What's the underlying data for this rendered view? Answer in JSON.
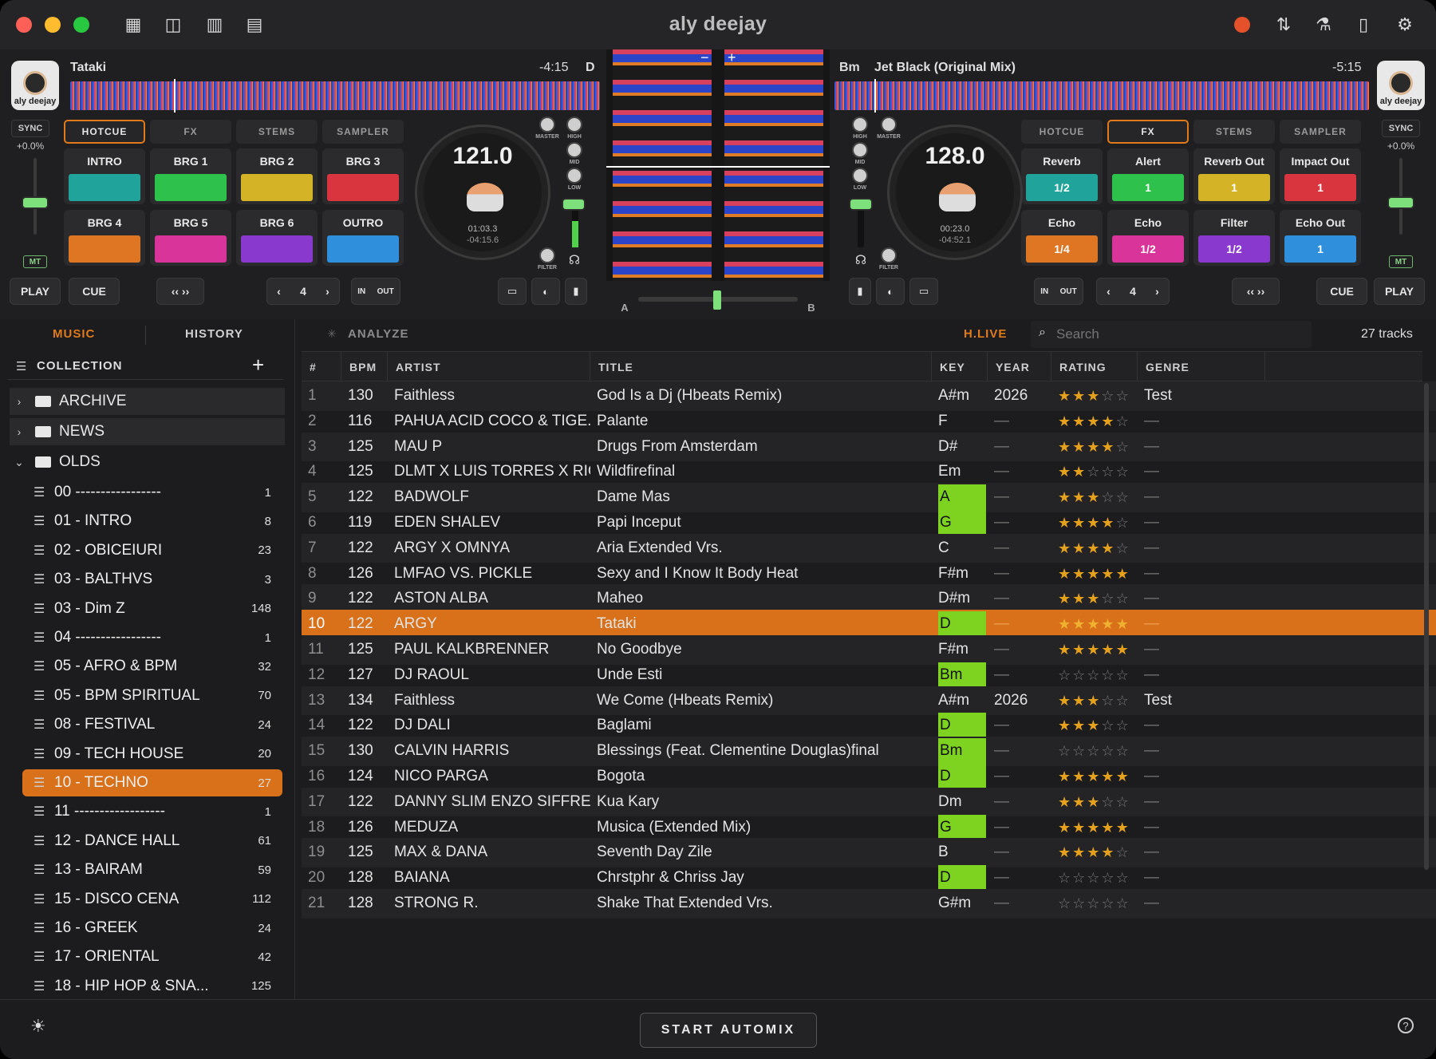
{
  "app": {
    "title": "aly deejay",
    "brand_badge": "aly deejay"
  },
  "deck_a": {
    "track": "Tataki",
    "remaining": "-4:15",
    "key": "D",
    "sync": "SYNC",
    "pitch": "+0.0%",
    "mt": "MT",
    "tabs": [
      "HOTCUE",
      "FX",
      "STEMS",
      "SAMPLER"
    ],
    "active_tab": 0,
    "pads": [
      {
        "label": "INTRO",
        "color": "#1fa39a",
        "value": ""
      },
      {
        "label": "BRG 1",
        "color": "#2ec24c",
        "value": ""
      },
      {
        "label": "BRG 2",
        "color": "#d4b426",
        "value": ""
      },
      {
        "label": "BRG 3",
        "color": "#d8353f",
        "value": ""
      },
      {
        "label": "BRG 4",
        "color": "#de7624",
        "value": ""
      },
      {
        "label": "BRG 5",
        "color": "#d8349a",
        "value": ""
      },
      {
        "label": "BRG 6",
        "color": "#8a39cf",
        "value": ""
      },
      {
        "label": "OUTRO",
        "color": "#2f8fdc",
        "value": ""
      }
    ],
    "bpm": "121.0",
    "elapsed": "01:03.3",
    "remaining_detail": "-04:15.6",
    "knob_labels": {
      "master": "MASTER",
      "high": "HIGH",
      "mid": "MID",
      "low": "LOW",
      "filter": "FILTER"
    },
    "buttons": {
      "play": "PLAY",
      "cue": "CUE",
      "loop_nav": "‹‹ ››",
      "loop_prev": "‹",
      "loop_size": "4",
      "loop_next": "›",
      "in": "IN",
      "out": "OUT"
    },
    "vu_level": 0.55
  },
  "deck_b": {
    "track": "Jet Black (Original Mix)",
    "remaining": "-5:15",
    "key": "Bm",
    "sync": "SYNC",
    "pitch": "+0.0%",
    "mt": "MT",
    "tabs": [
      "HOTCUE",
      "FX",
      "STEMS",
      "SAMPLER"
    ],
    "active_tab": 1,
    "pads": [
      {
        "label": "Reverb",
        "color": "#1fa39a",
        "value": "1/2"
      },
      {
        "label": "Alert",
        "color": "#2ec24c",
        "value": "1"
      },
      {
        "label": "Reverb Out",
        "color": "#d4b426",
        "value": "1"
      },
      {
        "label": "Impact Out",
        "color": "#d8353f",
        "value": "1"
      },
      {
        "label": "Echo",
        "color": "#de7624",
        "value": "1/4"
      },
      {
        "label": "Echo",
        "color": "#d8349a",
        "value": "1/2"
      },
      {
        "label": "Filter",
        "color": "#8a39cf",
        "value": "1/2"
      },
      {
        "label": "Echo Out",
        "color": "#2f8fdc",
        "value": "1"
      }
    ],
    "bpm": "128.0",
    "elapsed": "00:23.0",
    "remaining_detail": "-04:52.1",
    "knob_labels": {
      "master": "MASTER",
      "high": "HIGH",
      "mid": "MID",
      "low": "LOW",
      "filter": "FILTER"
    },
    "buttons": {
      "play": "PLAY",
      "cue": "CUE",
      "loop_nav": "‹‹ ››",
      "loop_prev": "‹",
      "loop_size": "4",
      "loop_next": "›",
      "in": "IN",
      "out": "OUT"
    },
    "vu_level": 0.0
  },
  "crossfader": {
    "left": "A",
    "right": "B",
    "position": 0.5
  },
  "sidebar": {
    "tabs": [
      "MUSIC",
      "HISTORY"
    ],
    "active_tab": 0,
    "collection_label": "COLLECTION",
    "add": "+",
    "folders": [
      {
        "name": "ARCHIVE",
        "expanded": false
      },
      {
        "name": "NEWS",
        "expanded": false
      },
      {
        "name": "OLDS",
        "expanded": true
      }
    ],
    "playlists": [
      {
        "name": "00 -----------------",
        "count": "1"
      },
      {
        "name": "01 - INTRO",
        "count": "8"
      },
      {
        "name": "02 - OBICEIURI",
        "count": "23"
      },
      {
        "name": "03 - BALTHVS",
        "count": "3"
      },
      {
        "name": "03 - Dim Z",
        "count": "148"
      },
      {
        "name": "04 -----------------",
        "count": "1"
      },
      {
        "name": "05 - AFRO & BPM",
        "count": "32"
      },
      {
        "name": "05 - BPM SPIRITUAL",
        "count": "70"
      },
      {
        "name": "08 - FESTIVAL",
        "count": "24"
      },
      {
        "name": "09 - TECH HOUSE",
        "count": "20"
      },
      {
        "name": "10 - TECHNO",
        "count": "27"
      },
      {
        "name": "11 ------------------",
        "count": "1"
      },
      {
        "name": "12 - DANCE HALL",
        "count": "61"
      },
      {
        "name": "13 - BAIRAM",
        "count": "59"
      },
      {
        "name": "15 - DISCO CENA",
        "count": "112"
      },
      {
        "name": "16 - GREEK",
        "count": "24"
      },
      {
        "name": "17 - ORIENTAL",
        "count": "42"
      },
      {
        "name": "18 - HIP HOP & SNA...",
        "count": "125"
      }
    ],
    "selected_playlist": 10
  },
  "toolbar": {
    "analyze": "ANALYZE",
    "live": "H.LIVE",
    "search_placeholder": "Search",
    "track_count": "27 tracks"
  },
  "table": {
    "columns": [
      "#",
      "BPM",
      "ARTIST",
      "TITLE",
      "KEY",
      "YEAR",
      "RATING",
      "GENRE"
    ],
    "selected_row": 9,
    "rows": [
      {
        "n": "1",
        "bpm": "130",
        "artist": "Faithless",
        "title": "God Is a Dj (Hbeats Remix)",
        "key": "A#m",
        "key_hl": false,
        "year": "2026",
        "rating": 3,
        "genre": "Test"
      },
      {
        "n": "2",
        "bpm": "116",
        "artist": "PAHUA ACID COCO & TIGE...",
        "title": "Palante",
        "key": "F",
        "key_hl": false,
        "year": "—",
        "rating": 4,
        "genre": "—"
      },
      {
        "n": "3",
        "bpm": "125",
        "artist": "MAU P",
        "title": "Drugs From Amsterdam",
        "key": "D#",
        "key_hl": false,
        "year": "—",
        "rating": 4,
        "genre": "—"
      },
      {
        "n": "4",
        "bpm": "125",
        "artist": "DLMT X LUIS TORRES X RIC...",
        "title": "Wildfirefinal",
        "key": "Em",
        "key_hl": false,
        "year": "—",
        "rating": 2,
        "genre": "—"
      },
      {
        "n": "5",
        "bpm": "122",
        "artist": "BADWOLF",
        "title": "Dame Mas",
        "key": "A",
        "key_hl": true,
        "year": "—",
        "rating": 3,
        "genre": "—"
      },
      {
        "n": "6",
        "bpm": "119",
        "artist": "EDEN SHALEV",
        "title": "Papi Inceput",
        "key": "G",
        "key_hl": true,
        "year": "—",
        "rating": 4,
        "genre": "—"
      },
      {
        "n": "7",
        "bpm": "122",
        "artist": "ARGY X OMNYA",
        "title": "Aria Extended Vrs.",
        "key": "C",
        "key_hl": false,
        "year": "—",
        "rating": 4,
        "genre": "—"
      },
      {
        "n": "8",
        "bpm": "126",
        "artist": "LMFAO VS. PICKLE",
        "title": "Sexy and I Know It Body Heat",
        "key": "F#m",
        "key_hl": false,
        "year": "—",
        "rating": 5,
        "genre": "—"
      },
      {
        "n": "9",
        "bpm": "122",
        "artist": "ASTON ALBA",
        "title": "Maheo",
        "key": "D#m",
        "key_hl": false,
        "year": "—",
        "rating": 3,
        "genre": "—"
      },
      {
        "n": "10",
        "bpm": "122",
        "artist": "ARGY",
        "title": "Tataki",
        "key": "D",
        "key_hl": true,
        "year": "—",
        "rating": 5,
        "genre": "—"
      },
      {
        "n": "11",
        "bpm": "125",
        "artist": "PAUL KALKBRENNER",
        "title": "No Goodbye",
        "key": "F#m",
        "key_hl": false,
        "year": "—",
        "rating": 5,
        "genre": "—"
      },
      {
        "n": "12",
        "bpm": "127",
        "artist": "DJ RAOUL",
        "title": "Unde Esti",
        "key": "Bm",
        "key_hl": true,
        "year": "—",
        "rating": 0,
        "genre": "—"
      },
      {
        "n": "13",
        "bpm": "134",
        "artist": "Faithless",
        "title": "We Come (Hbeats Remix)",
        "key": "A#m",
        "key_hl": false,
        "year": "2026",
        "rating": 3,
        "genre": "Test"
      },
      {
        "n": "14",
        "bpm": "122",
        "artist": "DJ DALI",
        "title": "Baglami",
        "key": "D",
        "key_hl": true,
        "year": "—",
        "rating": 3,
        "genre": "—"
      },
      {
        "n": "15",
        "bpm": "130",
        "artist": "CALVIN HARRIS",
        "title": "Blessings (Feat. Clementine Douglas)final",
        "key": "Bm",
        "key_hl": true,
        "year": "—",
        "rating": 0,
        "genre": "—"
      },
      {
        "n": "16",
        "bpm": "124",
        "artist": "NICO PARGA",
        "title": "Bogota",
        "key": "D",
        "key_hl": true,
        "year": "—",
        "rating": 5,
        "genre": "—"
      },
      {
        "n": "17",
        "bpm": "122",
        "artist": "DANNY SLIM ENZO SIFFREDI",
        "title": "Kua Kary",
        "key": "Dm",
        "key_hl": false,
        "year": "—",
        "rating": 3,
        "genre": "—"
      },
      {
        "n": "18",
        "bpm": "126",
        "artist": "MEDUZA",
        "title": "Musica (Extended Mix)",
        "key": "G",
        "key_hl": true,
        "year": "—",
        "rating": 5,
        "genre": "—"
      },
      {
        "n": "19",
        "bpm": "125",
        "artist": "MAX & DANA",
        "title": "Seventh Day Zile",
        "key": "B",
        "key_hl": false,
        "year": "—",
        "rating": 4,
        "genre": "—"
      },
      {
        "n": "20",
        "bpm": "128",
        "artist": "BAIANA",
        "title": "Chrstphr & Chriss Jay",
        "key": "D",
        "key_hl": true,
        "year": "—",
        "rating": 0,
        "genre": "—"
      },
      {
        "n": "21",
        "bpm": "128",
        "artist": "STRONG R.",
        "title": "Shake That Extended Vrs.",
        "key": "G#m",
        "key_hl": false,
        "year": "—",
        "rating": 0,
        "genre": "—"
      }
    ]
  },
  "bottom": {
    "automix": "START AUTOMIX"
  },
  "colors": {
    "accent": "#d9711a",
    "key_highlight": "#7ed321",
    "star": "#e5a11c"
  }
}
